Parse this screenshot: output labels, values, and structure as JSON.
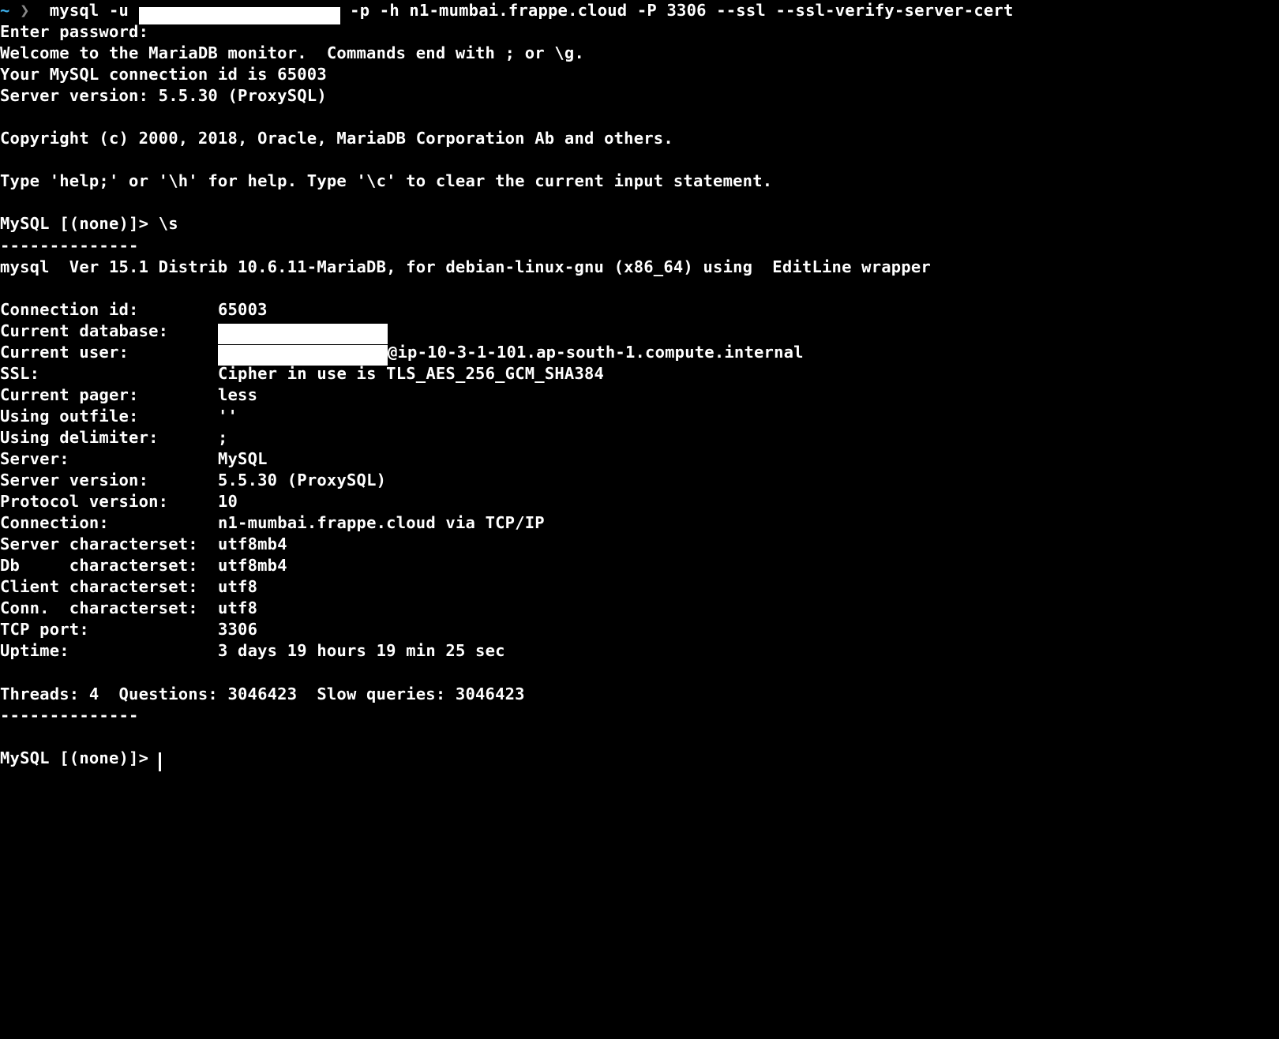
{
  "prompt": {
    "tilde": "~",
    "arrow": "❯",
    "cmd_pre": "mysql -u ",
    "cmd_post": " -p -h n1-mumbai.frappe.cloud -P 3306 --ssl --ssl-verify-server-cert"
  },
  "banner": {
    "enter_pw": "Enter password:",
    "welcome": "Welcome to the MariaDB monitor.  Commands end with ; or \\g.",
    "conn_id": "Your MySQL connection id is 65003",
    "server_ver": "Server version: 5.5.30 (ProxySQL)",
    "copyright": "Copyright (c) 2000, 2018, Oracle, MariaDB Corporation Ab and others.",
    "help": "Type 'help;' or '\\h' for help. Type '\\c' to clear the current input statement."
  },
  "cmd1": {
    "prompt": "MySQL [(none)]> ",
    "cmd": "\\s"
  },
  "rule": "--------------",
  "client_ver": "mysql  Ver 15.1 Distrib 10.6.11-MariaDB, for debian-linux-gnu (x86_64) using  EditLine wrapper",
  "status": {
    "conn_id": {
      "k": "Connection id:        ",
      "v": "65003"
    },
    "current_db": {
      "k": "Current database:     ",
      "v": ""
    },
    "current_user": {
      "k": "Current user:         ",
      "v": "@ip-10-3-1-101.ap-south-1.compute.internal"
    },
    "ssl": {
      "k": "SSL:                  ",
      "v": "Cipher in use is TLS_AES_256_GCM_SHA384"
    },
    "pager": {
      "k": "Current pager:        ",
      "v": "less"
    },
    "outfile": {
      "k": "Using outfile:        ",
      "v": "''"
    },
    "delimiter": {
      "k": "Using delimiter:      ",
      "v": ";"
    },
    "server": {
      "k": "Server:               ",
      "v": "MySQL"
    },
    "server_version": {
      "k": "Server version:       ",
      "v": "5.5.30 (ProxySQL)"
    },
    "protocol": {
      "k": "Protocol version:     ",
      "v": "10"
    },
    "connection": {
      "k": "Connection:           ",
      "v": "n1-mumbai.frappe.cloud via TCP/IP"
    },
    "server_cs": {
      "k": "Server characterset:  ",
      "v": "utf8mb4"
    },
    "db_cs": {
      "k": "Db     characterset:  ",
      "v": "utf8mb4"
    },
    "client_cs": {
      "k": "Client characterset:  ",
      "v": "utf8"
    },
    "conn_cs": {
      "k": "Conn.  characterset:  ",
      "v": "utf8"
    },
    "tcp_port": {
      "k": "TCP port:             ",
      "v": "3306"
    },
    "uptime": {
      "k": "Uptime:               ",
      "v": "3 days 19 hours 19 min 25 sec"
    }
  },
  "stats": "Threads: 4  Questions: 3046423  Slow queries: 3046423",
  "cmd2": {
    "prompt": "MySQL [(none)]> "
  }
}
